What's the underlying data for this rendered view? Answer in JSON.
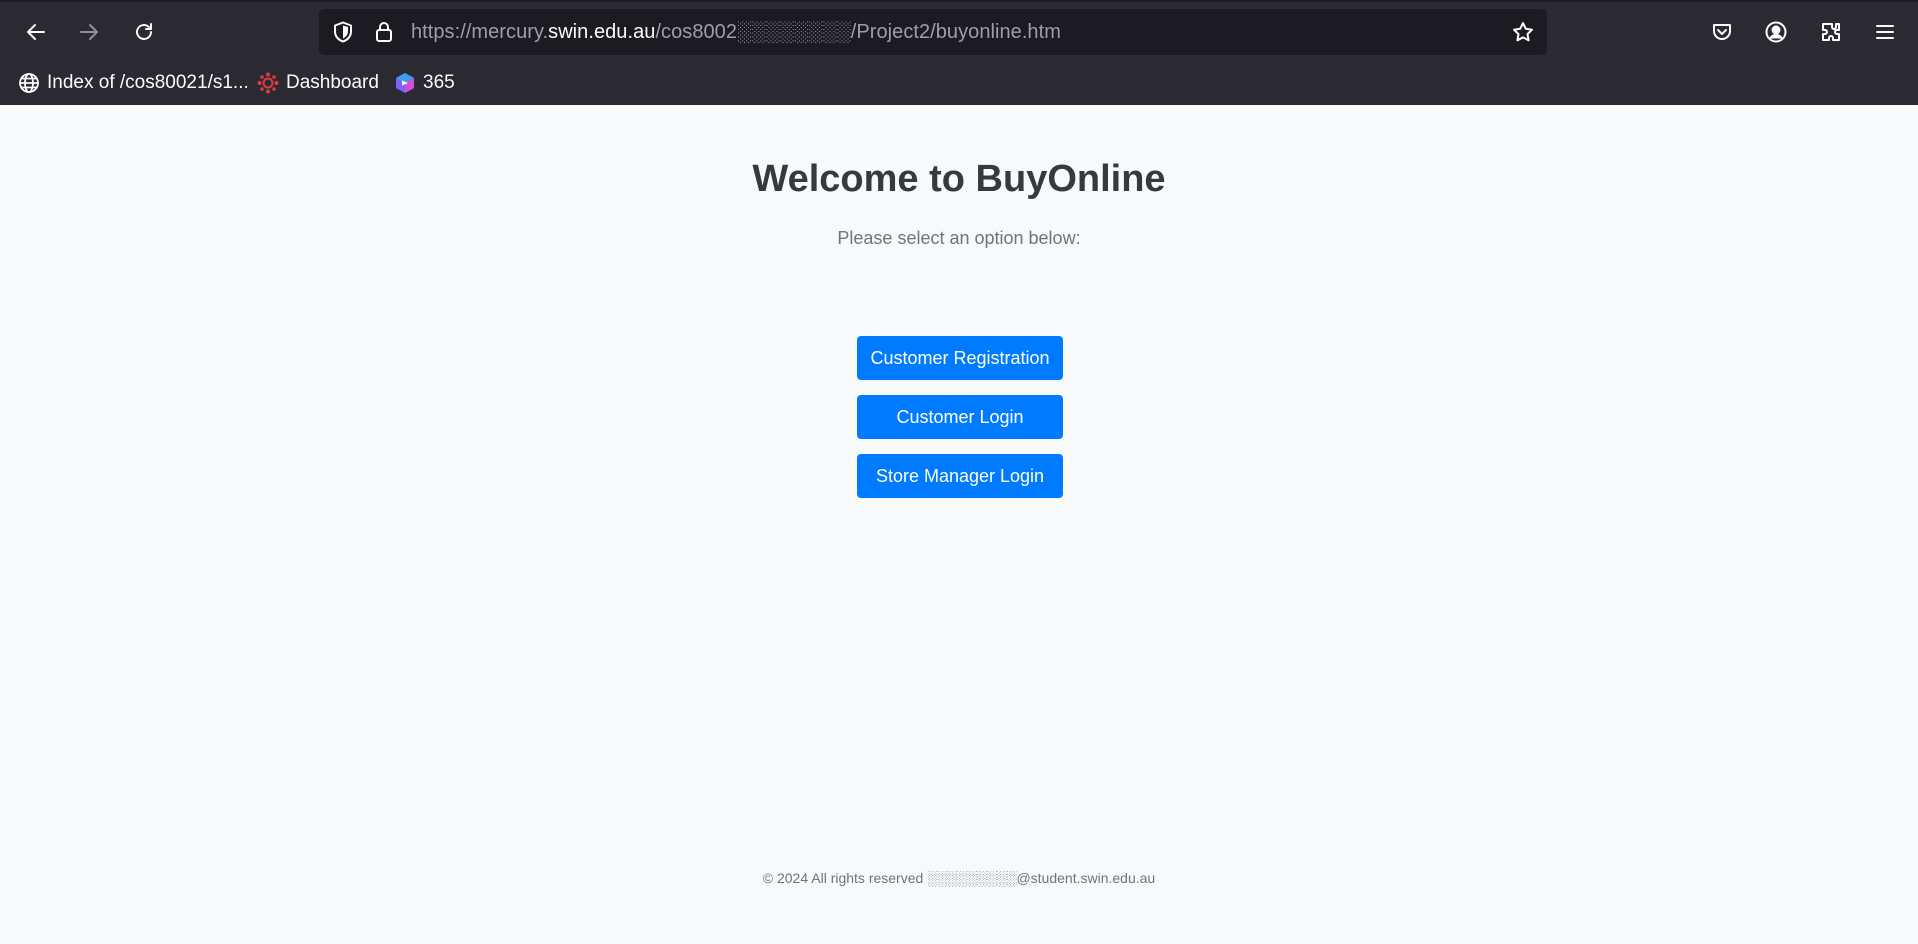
{
  "browser": {
    "url_prefix": "https://mercury.",
    "url_domain": "swin.edu.au",
    "url_path": "/cos8002░░░░░░░░/Project2/buyonline.htm",
    "icons": {
      "back": "back-arrow-icon",
      "forward": "forward-arrow-icon",
      "reload": "reload-icon",
      "tracking_protection": "shield-icon",
      "secure": "lock-icon",
      "bookmark": "star-icon",
      "pocket": "pocket-icon",
      "account": "account-icon",
      "extensions": "puzzle-icon",
      "menu": "hamburger-menu-icon"
    },
    "bookmarks": [
      {
        "label": "Index of /cos80021/s1...",
        "icon": "globe-icon"
      },
      {
        "label": "Dashboard",
        "icon": "canvas-icon"
      },
      {
        "label": "365",
        "icon": "microsoft-365-icon"
      }
    ],
    "colors": {
      "chrome_bg": "#2b2a33",
      "urlbar_bg": "#1c1b22"
    }
  },
  "page": {
    "title": "Welcome to BuyOnline",
    "subtitle": "Please select an option below:",
    "buttons": {
      "register": "Customer Registration",
      "login": "Customer Login",
      "manager": "Store Manager Login"
    },
    "footer": "© 2024 All rights reserved ░░░░░░░░░@student.swin.edu.au",
    "colors": {
      "background": "#f8f9fa",
      "title": "#343a40",
      "muted": "#6c757d",
      "primary": "#007bff"
    }
  }
}
